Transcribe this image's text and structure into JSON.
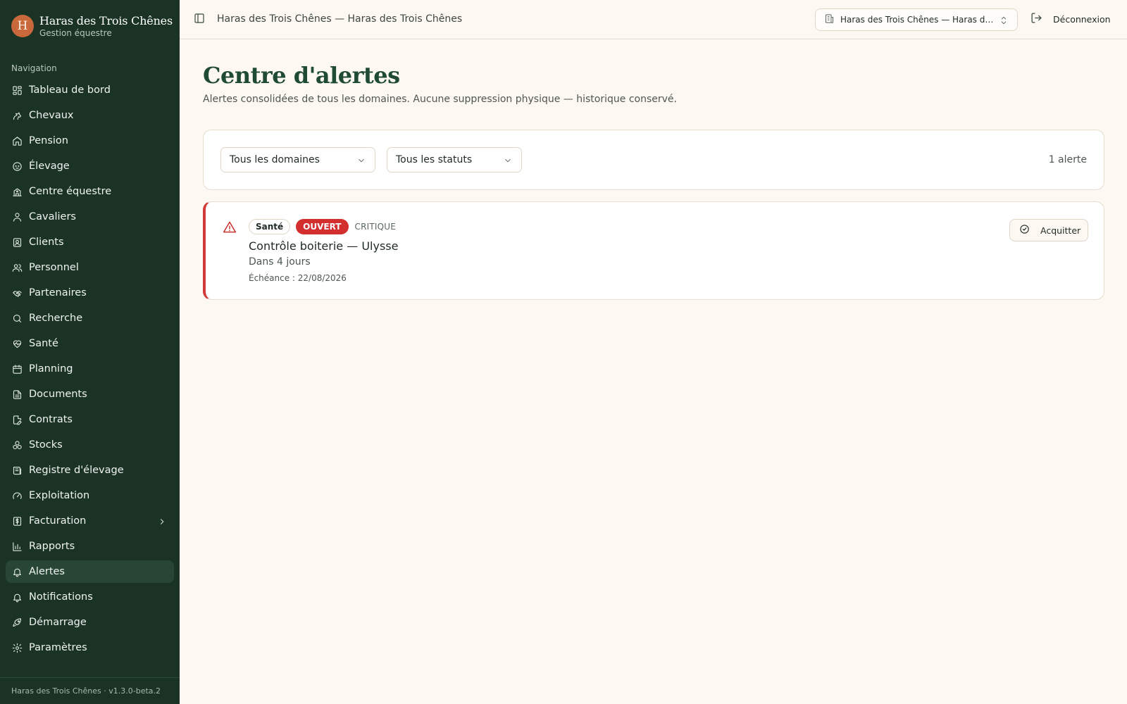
{
  "brand": {
    "initial": "H",
    "name": "Haras des Trois Chênes",
    "subtitle": "Gestion équestre"
  },
  "sidebar": {
    "heading": "Navigation",
    "items": [
      {
        "label": "Tableau de bord",
        "icon": "dashboard-icon"
      },
      {
        "label": "Chevaux",
        "icon": "horse-icon"
      },
      {
        "label": "Pension",
        "icon": "home-icon"
      },
      {
        "label": "Élevage",
        "icon": "baby-icon"
      },
      {
        "label": "Centre équestre",
        "icon": "school-icon"
      },
      {
        "label": "Cavaliers",
        "icon": "rider-icon"
      },
      {
        "label": "Clients",
        "icon": "contact-icon"
      },
      {
        "label": "Personnel",
        "icon": "users-icon"
      },
      {
        "label": "Partenaires",
        "icon": "handshake-icon"
      },
      {
        "label": "Recherche",
        "icon": "search-icon"
      },
      {
        "label": "Santé",
        "icon": "heart-pulse-icon"
      },
      {
        "label": "Planning",
        "icon": "calendar-icon"
      },
      {
        "label": "Documents",
        "icon": "file-text-icon"
      },
      {
        "label": "Contrats",
        "icon": "file-signature-icon"
      },
      {
        "label": "Stocks",
        "icon": "boxes-icon"
      },
      {
        "label": "Registre d'élevage",
        "icon": "book-icon"
      },
      {
        "label": "Exploitation",
        "icon": "gauge-icon"
      },
      {
        "label": "Facturation",
        "icon": "receipt-icon",
        "has_submenu": true
      },
      {
        "label": "Rapports",
        "icon": "bar-chart-icon"
      },
      {
        "label": "Alertes",
        "icon": "bell-icon",
        "active": true
      },
      {
        "label": "Notifications",
        "icon": "bell-icon"
      },
      {
        "label": "Démarrage",
        "icon": "rocket-icon"
      },
      {
        "label": "Paramètres",
        "icon": "gear-icon"
      }
    ],
    "footer": "Haras des Trois Chênes · v1.3.0-beta.2"
  },
  "topbar": {
    "title": "Haras des Trois Chênes — Haras des Trois Chênes",
    "org_select": "Haras des Trois Chênes — Haras de...",
    "logout": "Déconnexion"
  },
  "main": {
    "title": "Centre d'alertes",
    "subtitle": "Alertes consolidées de tous les domaines. Aucune suppression physique — historique conservé.",
    "filters": {
      "domain": "Tous les domaines",
      "status": "Tous les statuts",
      "count": "1 alerte"
    },
    "alerts": [
      {
        "domain": "Santé",
        "status": "OUVERT",
        "severity": "CRITIQUE",
        "title": "Contrôle boiterie — Ulysse",
        "when": "Dans 4 jours",
        "due": "Échéance : 22/08/2026",
        "action": "Acquitter"
      }
    ]
  },
  "colors": {
    "sidebar_bg": "#1a3324",
    "page_bg": "#fdf8f1",
    "accent_green": "#1f4a33",
    "brand_orange": "#c8683b",
    "critical_red": "#d32f2f"
  }
}
